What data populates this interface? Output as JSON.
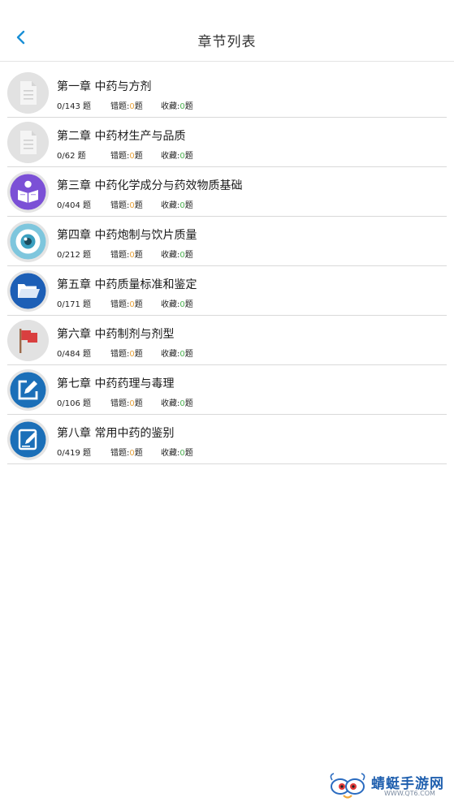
{
  "header": {
    "title": "章节列表",
    "back_icon": "chevron-left-icon"
  },
  "colors": {
    "accent": "#1a8fd6",
    "wrong_count": "#e6a23c",
    "fav_count": "#4caf50"
  },
  "chapters": [
    {
      "title": "第一章 中药与方剂",
      "progress": "0/143 题",
      "wrong_label": "错题:",
      "wrong": "0",
      "wrong_unit": "题",
      "fav_label": "收藏:",
      "fav": "0",
      "fav_unit": "题",
      "icon": "document-icon"
    },
    {
      "title": "第二章 中药材生产与品质",
      "progress": "0/62 题",
      "wrong_label": "错题:",
      "wrong": "0",
      "wrong_unit": "题",
      "fav_label": "收藏:",
      "fav": "0",
      "fav_unit": "题",
      "icon": "document-icon"
    },
    {
      "title": "第三章 中药化学成分与药效物质基础",
      "progress": "0/404 题",
      "wrong_label": "错题:",
      "wrong": "0",
      "wrong_unit": "题",
      "fav_label": "收藏:",
      "fav": "0",
      "fav_unit": "题",
      "icon": "reader-icon"
    },
    {
      "title": "第四章 中药炮制与饮片质量",
      "progress": "0/212 题",
      "wrong_label": "错题:",
      "wrong": "0",
      "wrong_unit": "题",
      "fav_label": "收藏:",
      "fav": "0",
      "fav_unit": "题",
      "icon": "eye-icon"
    },
    {
      "title": "第五章 中药质量标准和鉴定",
      "progress": "0/171 题",
      "wrong_label": "错题:",
      "wrong": "0",
      "wrong_unit": "题",
      "fav_label": "收藏:",
      "fav": "0",
      "fav_unit": "题",
      "icon": "folder-icon"
    },
    {
      "title": "第六章 中药制剂与剂型",
      "progress": "0/484 题",
      "wrong_label": "错题:",
      "wrong": "0",
      "wrong_unit": "题",
      "fav_label": "收藏:",
      "fav": "0",
      "fav_unit": "题",
      "icon": "flag-icon"
    },
    {
      "title": "第七章 中药药理与毒理",
      "progress": "0/106 题",
      "wrong_label": "错题:",
      "wrong": "0",
      "wrong_unit": "题",
      "fav_label": "收藏:",
      "fav": "0",
      "fav_unit": "题",
      "icon": "edit-icon"
    },
    {
      "title": "第八章 常用中药的鉴别",
      "progress": "0/419 题",
      "wrong_label": "错题:",
      "wrong": "0",
      "wrong_unit": "题",
      "fav_label": "收藏:",
      "fav": "0",
      "fav_unit": "题",
      "icon": "edit-note-icon"
    }
  ],
  "watermark": {
    "brand": "蜻蜓手游网",
    "url": "WWW.QT6.COM"
  }
}
